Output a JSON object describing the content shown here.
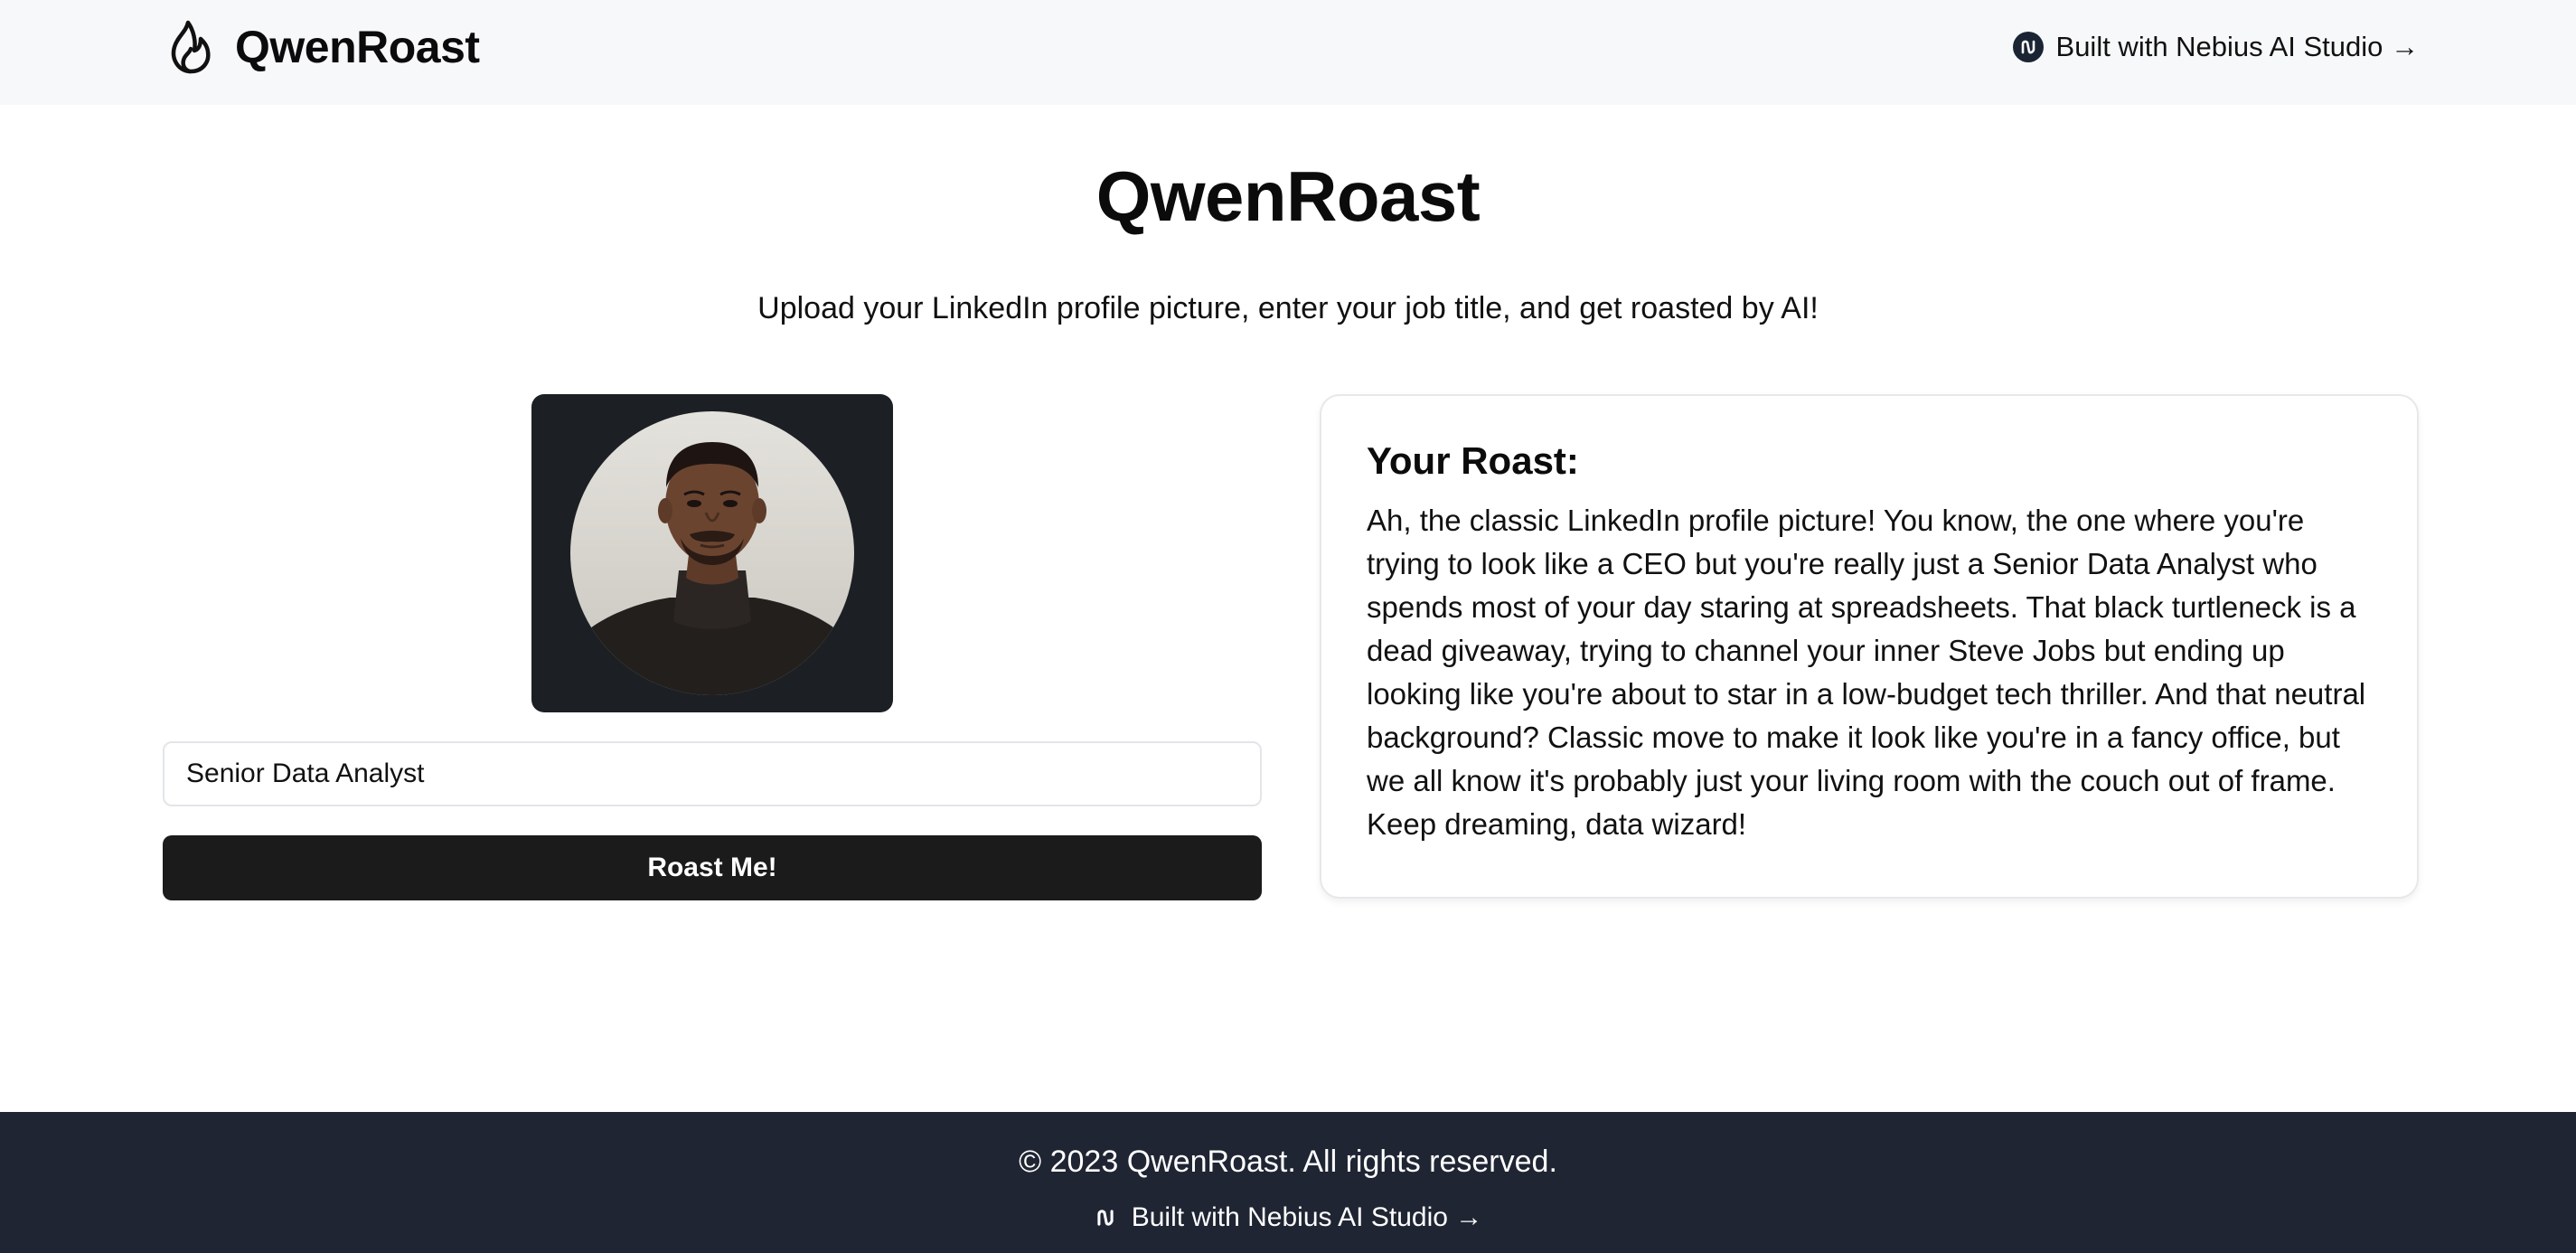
{
  "header": {
    "brand_name": "QwenRoast",
    "brand_icon": "flame-icon",
    "nebius_link": "Built with Nebius AI Studio →",
    "nebius_icon": "nebius-logo-icon"
  },
  "hero": {
    "title": "QwenRoast",
    "subtitle": "Upload your LinkedIn profile picture, enter your job title, and get roasted by AI!"
  },
  "form": {
    "job_title_value": "Senior Data Analyst",
    "submit_label": "Roast Me!"
  },
  "result": {
    "heading": "Your Roast:",
    "text": "Ah, the classic LinkedIn profile picture! You know, the one where you're trying to look like a CEO but you're really just a Senior Data Analyst who spends most of your day staring at spreadsheets. That black turtleneck is a dead giveaway, trying to channel your inner Steve Jobs but ending up looking like you're about to star in a low-budget tech thriller. And that neutral background? Classic move to make it look like you're in a fancy office, but we all know it's probably just your living room with the couch out of frame. Keep dreaming, data wizard!"
  },
  "footer": {
    "copyright": "© 2023 QwenRoast. All rights reserved.",
    "nebius_link": "Built with Nebius AI Studio →"
  },
  "colors": {
    "header_bg": "#f7f8f9",
    "button_bg": "#1b1b1b",
    "photo_frame_bg": "#1c1f24",
    "footer_bg": "#1f2533"
  }
}
